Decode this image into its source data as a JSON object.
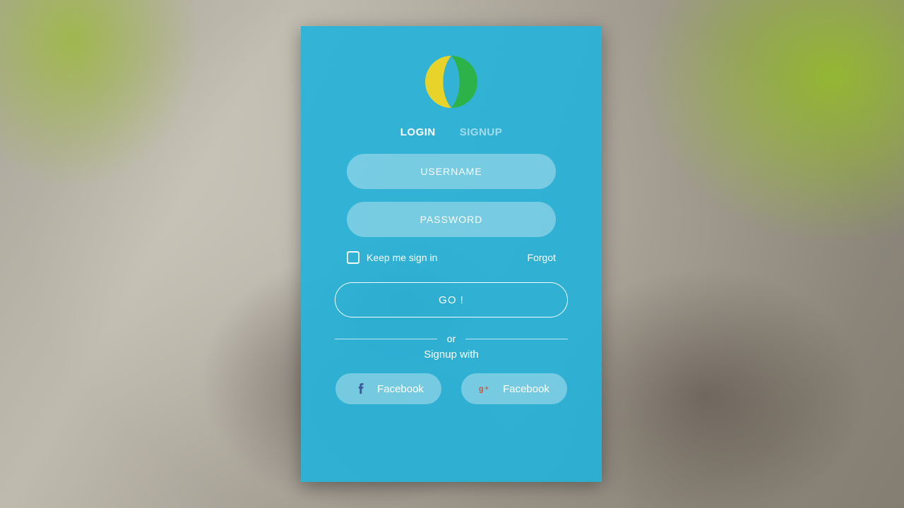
{
  "tabs": {
    "login": "LOGIN",
    "signup": "SIGNUP"
  },
  "fields": {
    "username": {
      "placeholder": "USERNAME",
      "value": ""
    },
    "password": {
      "placeholder": "PASSWORD",
      "value": ""
    }
  },
  "options": {
    "keep_signed_in_label": "Keep me sign in",
    "forgot_label": "Forgot"
  },
  "go_label": "GO !",
  "separator": "or",
  "signup_with": "Signup with",
  "social": {
    "facebook_label": "Facebook",
    "google_label": "Facebook"
  },
  "colors": {
    "card_bg": "#21afd6",
    "pill_bg_alpha": "rgba(255,255,255,0.34)",
    "logo_yellow": "#e7d32a",
    "logo_green": "#2db24a",
    "fb_blue": "#3b5998",
    "g_red": "#dd4b39"
  },
  "icons": {
    "logo": "logo-icon",
    "facebook": "facebook-icon",
    "google": "google-plus-icon",
    "checkbox": "checkbox-icon"
  }
}
